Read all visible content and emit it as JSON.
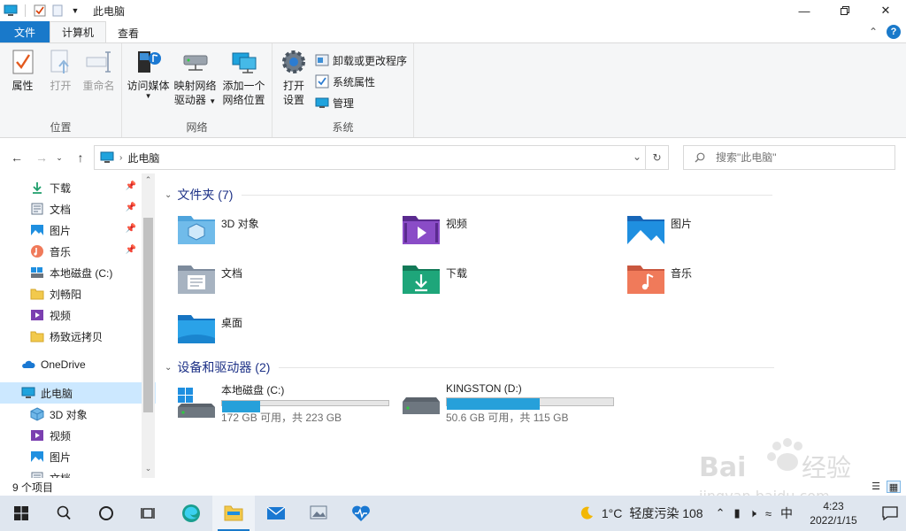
{
  "window": {
    "title": "此电脑"
  },
  "ribbon_tabs": [
    {
      "label": "文件"
    },
    {
      "label": "计算机"
    },
    {
      "label": "查看"
    }
  ],
  "ribbon": {
    "location_group": {
      "label": "位置",
      "properties": "属性",
      "open": "打开",
      "rename": "重命名"
    },
    "network_group": {
      "label": "网络",
      "media_line1": "访问媒体",
      "map_line1": "映射网络",
      "map_line2": "驱动器",
      "add_line1": "添加一个",
      "add_line2": "网络位置"
    },
    "system_group": {
      "label": "系统",
      "settings_line1": "打开",
      "settings_line2": "设置",
      "uninstall": "卸载或更改程序",
      "sys_props": "系统属性",
      "manage": "管理"
    }
  },
  "address": {
    "path": "此电脑",
    "search_placeholder": "搜索\"此电脑\""
  },
  "nav_pane": {
    "quick_access": [
      {
        "label": "下载",
        "icon": "download-icon",
        "pinned": true
      },
      {
        "label": "文档",
        "icon": "document-icon",
        "pinned": true
      },
      {
        "label": "图片",
        "icon": "picture-icon",
        "pinned": true
      },
      {
        "label": "音乐",
        "icon": "music-icon",
        "pinned": true
      },
      {
        "label": "本地磁盘 (C:)",
        "icon": "drive-icon",
        "pinned": false
      },
      {
        "label": "刘畅阳",
        "icon": "folder-icon",
        "pinned": false
      },
      {
        "label": "视频",
        "icon": "video-icon",
        "pinned": false
      },
      {
        "label": "杨致远拷贝",
        "icon": "folder-icon",
        "pinned": false
      }
    ],
    "onedrive": "OneDrive",
    "this_pc": "此电脑",
    "pc_children": [
      {
        "label": "3D 对象",
        "icon": "cube-icon"
      },
      {
        "label": "视频",
        "icon": "video-icon"
      },
      {
        "label": "图片",
        "icon": "picture-icon"
      },
      {
        "label": "文档",
        "icon": "document-icon"
      }
    ]
  },
  "folders_section": {
    "title": "文件夹 (7)",
    "items": [
      {
        "label": "3D 对象",
        "icon": "3d-objects-folder-icon"
      },
      {
        "label": "视频",
        "icon": "videos-folder-icon"
      },
      {
        "label": "图片",
        "icon": "pictures-folder-icon"
      },
      {
        "label": "文档",
        "icon": "documents-folder-icon"
      },
      {
        "label": "下载",
        "icon": "downloads-folder-icon"
      },
      {
        "label": "音乐",
        "icon": "music-folder-icon"
      },
      {
        "label": "桌面",
        "icon": "desktop-folder-icon"
      }
    ]
  },
  "drives_section": {
    "title": "设备和驱动器 (2)",
    "items": [
      {
        "label": "本地磁盘 (C:)",
        "free": "172 GB 可用，共 223 GB",
        "used_fraction": 0.23
      },
      {
        "label": "KINGSTON (D:)",
        "free": "50.6 GB 可用，共 115 GB",
        "used_fraction": 0.56
      }
    ]
  },
  "status": {
    "item_count": "9 个项目"
  },
  "taskbar": {
    "temperature": "1°C",
    "air_quality": "轻度污染 108",
    "ime": "中",
    "time": "4:23",
    "date": "2022/1/15"
  },
  "colors": {
    "accent": "#1979ca",
    "drive_bar": "#26a0da",
    "section_title": "#1e3287",
    "selection": "#cce8ff"
  }
}
